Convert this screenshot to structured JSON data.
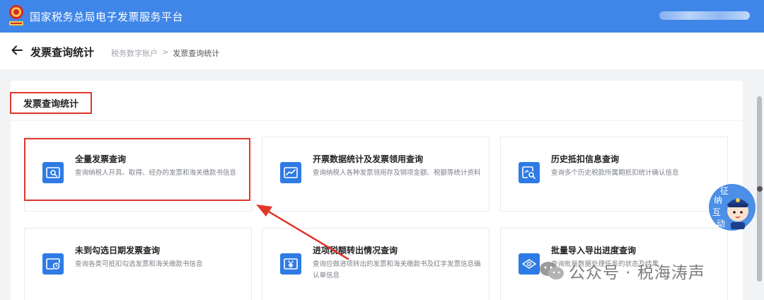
{
  "topbar": {
    "app_title": "国家税务总局电子发票服务平台"
  },
  "header": {
    "title": "发票查询统计",
    "breadcrumb": [
      "税务数字账户",
      "发票查询统计"
    ],
    "breadcrumb_sep": ">"
  },
  "section": {
    "title": "发票查询统计"
  },
  "cards": [
    {
      "title": "全量发票查询",
      "desc": "查询纳税人开具、取得、经办的发票和海关缴款书信息",
      "icon": "search-doc-icon"
    },
    {
      "title": "开票数据统计及发票领用查询",
      "desc": "查询纳税人各种发票领用存及销项金额、税额等统计资料",
      "icon": "chart-doc-icon"
    },
    {
      "title": "历史抵扣信息查询",
      "desc": "查询多个历史税款所属期抵扣统计确认信息",
      "icon": "history-search-icon"
    },
    {
      "title": "未到勾选日期发票查询",
      "desc": "查询各类可抵扣勾选发票和海关缴款书信息",
      "icon": "clock-doc-icon"
    },
    {
      "title": "进项税额转出情况查询",
      "desc": "查询应做进项转出的发票和海关缴款书及红字发票信息确认单信息",
      "icon": "yen-doc-icon"
    },
    {
      "title": "批量导入导出进度查询",
      "desc": "查询批量数据处理任务的状态及结果",
      "icon": "batch-eye-icon"
    }
  ],
  "mascot": {
    "chars": [
      "征",
      "纳",
      "互",
      "动"
    ]
  },
  "watermark": {
    "text": "公众号 · 税海涛声"
  },
  "colors": {
    "brand": "#3f86e8",
    "icon_bg": "#2f7be5",
    "highlight": "#e0372c"
  }
}
